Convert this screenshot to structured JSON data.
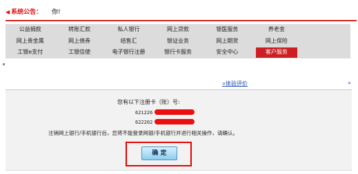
{
  "notice": {
    "label": "系统公告：",
    "message": "你!"
  },
  "nav": {
    "items": [
      {
        "label": "公益捐款"
      },
      {
        "label": "转账汇款"
      },
      {
        "label": "私人银行"
      },
      {
        "label": "网上贷款"
      },
      {
        "label": "银医服务"
      },
      {
        "label": "养老金"
      },
      {
        "label": ""
      },
      {
        "label": "网上贵金属"
      },
      {
        "label": "网上债券"
      },
      {
        "label": "结售汇"
      },
      {
        "label": "银证业务"
      },
      {
        "label": "网上期货"
      },
      {
        "label": "网上保险"
      },
      {
        "label": ""
      },
      {
        "label": "工银e支付"
      },
      {
        "label": "工银信使"
      },
      {
        "label": "电子银行注册"
      },
      {
        "label": "银行卡服务"
      },
      {
        "label": "安全中心"
      },
      {
        "label": "客户服务",
        "active": true
      },
      {
        "label": ""
      }
    ]
  },
  "feedback": {
    "arrow": "»",
    "label": "体验评价",
    "tail": "»"
  },
  "confirm": {
    "heading": "您有以下注册卡（账）号:",
    "cards": [
      {
        "prefix": "621226"
      },
      {
        "prefix": "622202"
      }
    ],
    "warning": "注销网上银行/手机银行后，您将不能登录网银/手机银行并进行相关操作，请确认。",
    "button_label": "确  定"
  },
  "colors": {
    "accent_red": "#d61f1f",
    "nav_bg": "#dcdcdc",
    "link_blue": "#1f4fb5",
    "button_gradient_top": "#d8f1ff",
    "button_gradient_bottom": "#8ccdef"
  }
}
